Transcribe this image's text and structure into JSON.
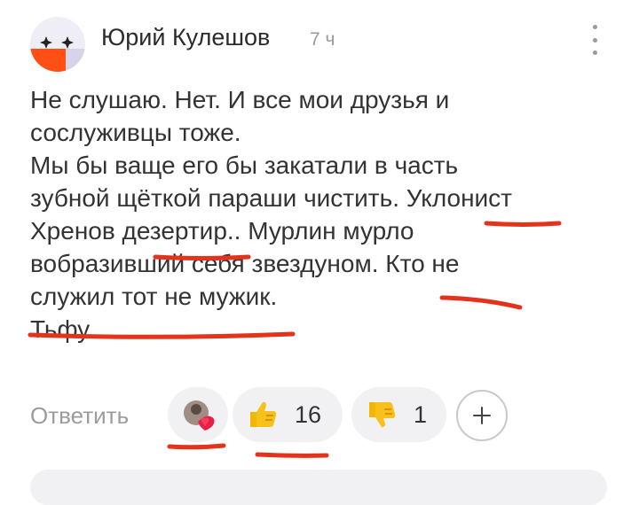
{
  "author": {
    "name": "Юрий Кулешов",
    "time": "7 ч"
  },
  "comment": {
    "lines": [
      "Не слушаю. Нет. И все мои друзья и",
      "сослуживцы тоже.",
      "Мы бы ваще его бы закатали в часть",
      "зубной щёткой параши чистить. Уклонист",
      "Хренов дезертир.. Мурлин мурло",
      "вобразивший себя звездуном. Кто не",
      "служил тот не мужик.",
      "Тьфу"
    ]
  },
  "actions": {
    "reply_label": "Ответить",
    "like_count": "16",
    "dislike_count": "1"
  },
  "colors": {
    "underline": "#e3331d",
    "pill": "#f1f1f4",
    "meta": "#9a9a9a"
  },
  "icons": {
    "menu": "vertical-dots-icon",
    "reactions": "reactions-avatar-heart-icon",
    "like": "thumbs-up-icon",
    "dislike": "thumbs-down-icon",
    "add": "plus-icon"
  }
}
